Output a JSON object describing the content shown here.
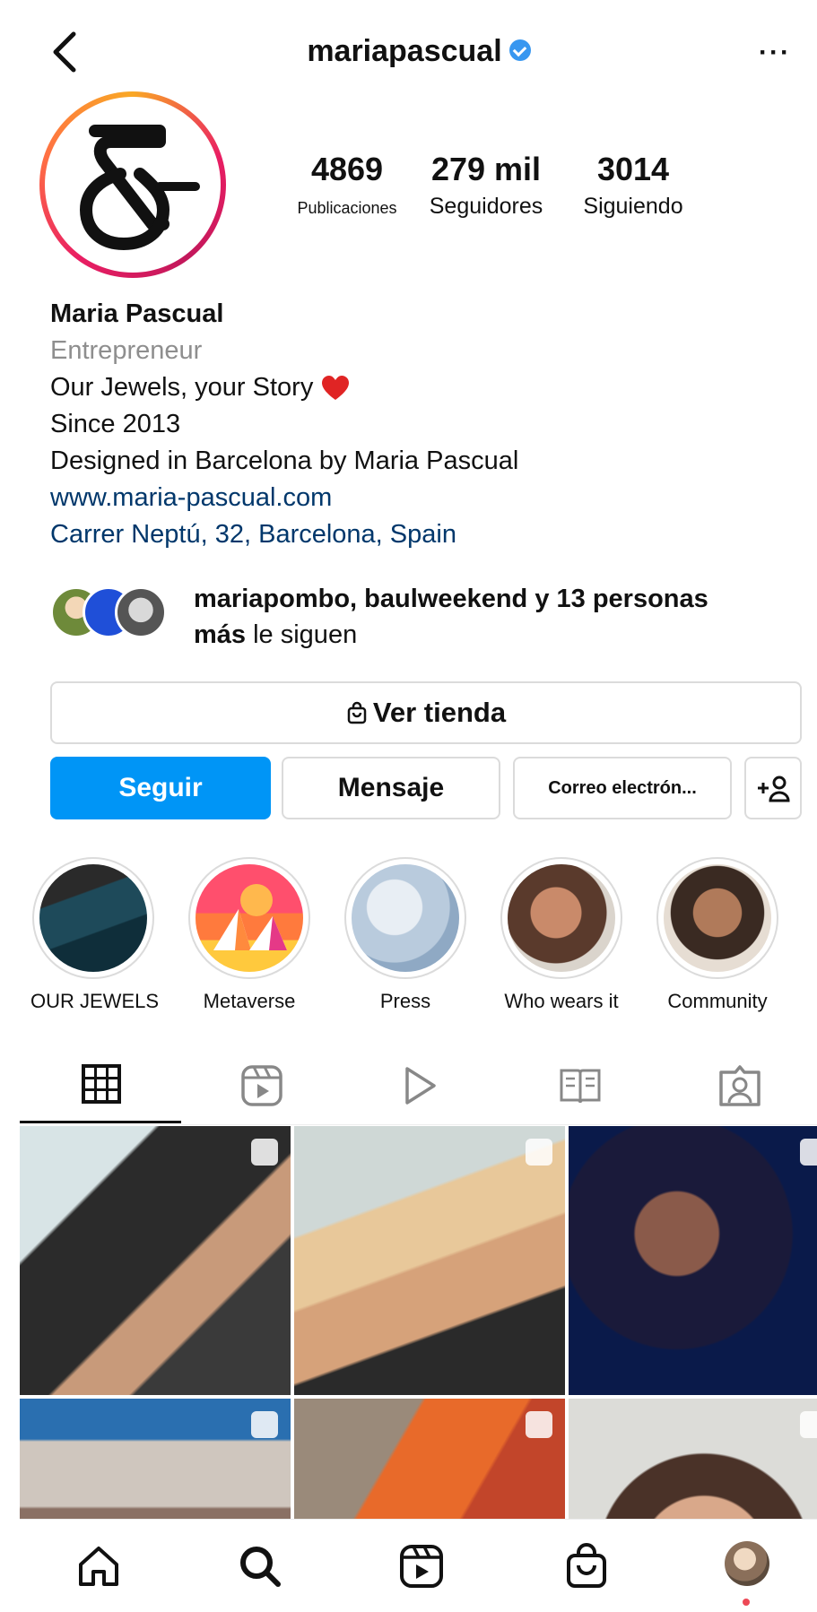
{
  "header": {
    "back_icon": "chevron-left-icon",
    "username": "mariapascual",
    "verified_icon": "verified-badge-icon",
    "more_icon": "more-horizontal-icon"
  },
  "profile": {
    "avatar_icon": "ampersand-logo",
    "stats": [
      {
        "value": "4869",
        "label": "Publicaciones"
      },
      {
        "value": "279 mil",
        "label": "Seguidores"
      },
      {
        "value": "3014",
        "label": "Siguiendo"
      }
    ],
    "name": "Maria Pascual",
    "category": "Entrepreneur",
    "bio_lines": [
      "Our Jewels, your Story",
      "Since 2013",
      "Designed in Barcelona by Maria Pascual"
    ],
    "heart_icon": "red-heart-emoji",
    "website": "www.maria-pascual.com",
    "address": "Carrer Neptú, 32, Barcelona, Spain"
  },
  "followed_by": {
    "names": "mariapombo, baulweekend y 13 personas",
    "mas": "más",
    "suffix": "le siguen"
  },
  "buttons": {
    "shop_icon": "shopping-bag-icon",
    "shop": "Ver tienda",
    "follow": "Seguir",
    "message": "Mensaje",
    "email": "Correo electrón...",
    "add_person_icon": "add-person-icon"
  },
  "highlights": [
    {
      "label": "OUR JEWELS"
    },
    {
      "label": "Metaverse"
    },
    {
      "label": "Press"
    },
    {
      "label": "Who wears it"
    },
    {
      "label": "Community"
    }
  ],
  "tabs": [
    {
      "icon": "grid-icon",
      "active": true
    },
    {
      "icon": "reels-icon"
    },
    {
      "icon": "play-icon"
    },
    {
      "icon": "guide-icon"
    },
    {
      "icon": "tagged-icon"
    }
  ],
  "bottom_nav": [
    "home-icon",
    "search-icon",
    "reels-icon",
    "shop-icon",
    "profile-avatar"
  ],
  "colors": {
    "primary": "#0095f6",
    "link": "#00376b",
    "muted": "#8e8e8e",
    "border": "#dbdbdb",
    "notification": "#ed4956"
  }
}
